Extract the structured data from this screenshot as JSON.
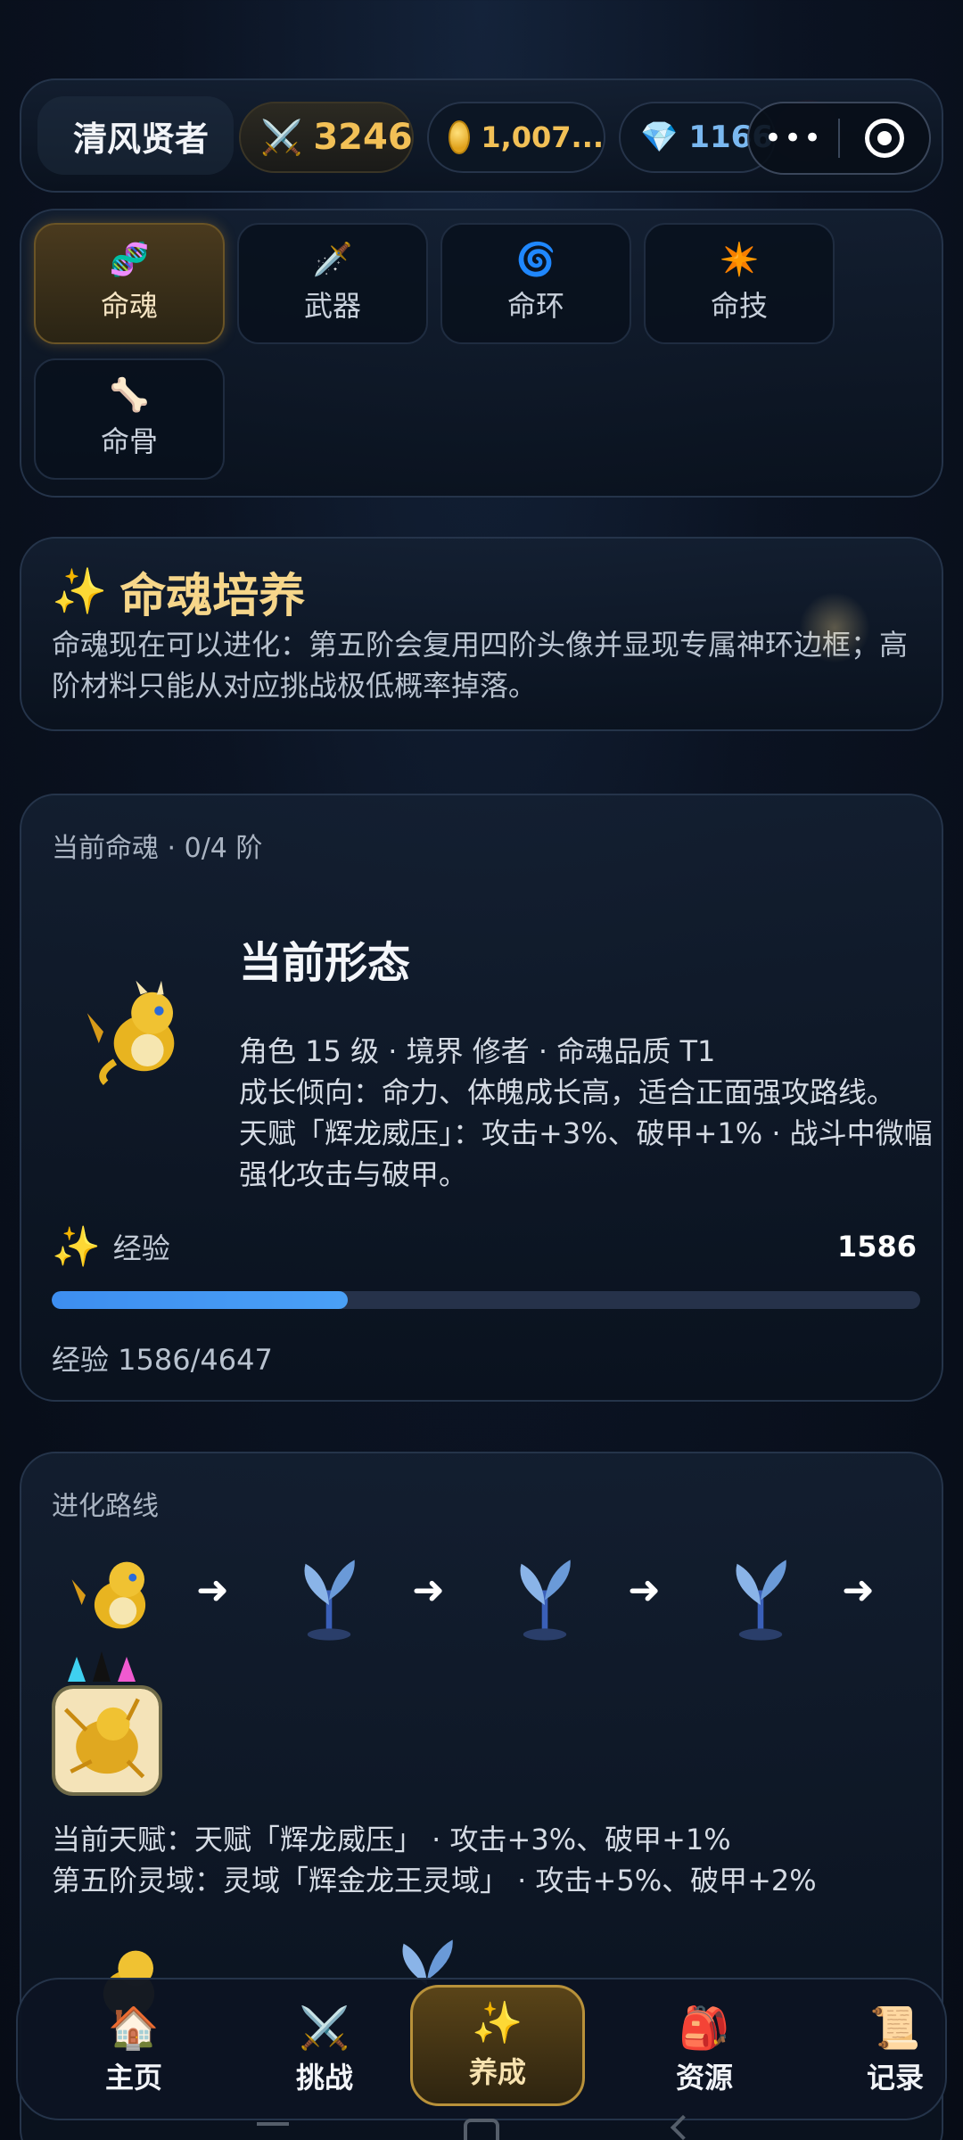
{
  "header": {
    "player_name": "清风贤者",
    "power": "3246",
    "coins": "1,007...",
    "gems": "1166",
    "more_label": "•••",
    "icons": {
      "power": "crossed-swords-icon",
      "coins": "coin-icon",
      "gems": "diamond-icon"
    }
  },
  "tabs": [
    {
      "label": "命魂",
      "icon": "dna-icon",
      "active": true
    },
    {
      "label": "武器",
      "icon": "dagger-icon",
      "active": false
    },
    {
      "label": "命环",
      "icon": "spiral-icon",
      "active": false
    },
    {
      "label": "命技",
      "icon": "burst-icon",
      "active": false
    },
    {
      "label": "命骨",
      "icon": "bone-icon",
      "active": false
    }
  ],
  "intro": {
    "title": "命魂培养",
    "text": "命魂现在可以进化：第五阶会复用四阶头像并显现专属神环边框；高阶材料只能从对应挑战极低概率掉落。"
  },
  "current_form": {
    "section_label": "当前命魂 · 0/4 阶",
    "title": "当前形态",
    "lines": [
      "角色 15 级 · 境界 修者 · 命魂品质 T1",
      "成长倾向：命力、体魄成长高，适合正面强攻路线。",
      "天赋「辉龙威压」：攻击+3%、破甲+1% · 战斗中微幅强化攻击与破甲。"
    ],
    "exp_label": "经验",
    "exp_value": "1586",
    "exp_progress": 0.341,
    "exp_text": "经验 1586/4647"
  },
  "evolution": {
    "section_label": "进化路线",
    "nodes": [
      "golden-dragon",
      "crystal-sprout",
      "crystal-sprout",
      "crystal-sprout",
      "golden-dragon-framed"
    ],
    "current_talent": "当前天赋：天赋「辉龙威压」 · 攻击+3%、破甲+1%",
    "fifth_domain": "第五阶灵域：灵域「辉金龙王灵域」 · 攻击+5%、破甲+2%"
  },
  "bottom_nav": [
    {
      "label": "主页",
      "icon": "house-icon",
      "active": false
    },
    {
      "label": "挑战",
      "icon": "crossed-swords-icon",
      "active": false
    },
    {
      "label": "养成",
      "icon": "sparkles-icon",
      "active": true
    },
    {
      "label": "资源",
      "icon": "backpack-icon",
      "active": false
    },
    {
      "label": "记录",
      "icon": "scroll-icon",
      "active": false
    }
  ],
  "colors": {
    "accent_gold": "#f6d68a",
    "exp_bar": "#3d8ef0",
    "power": "#f2c056",
    "gems": "#7ab8f0"
  }
}
